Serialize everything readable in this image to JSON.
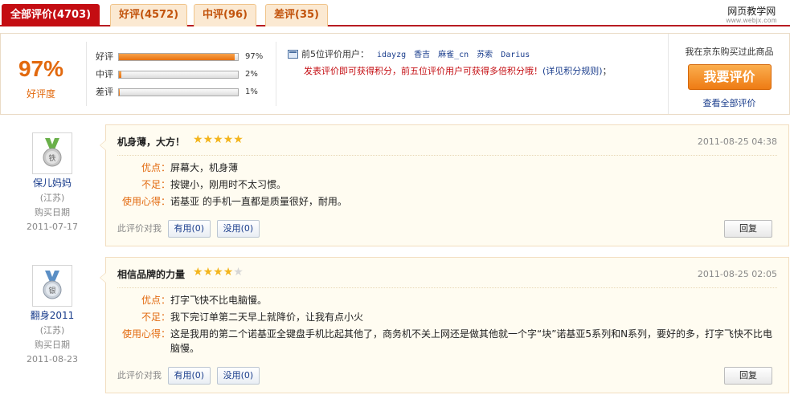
{
  "tabs": [
    {
      "label": "全部评价",
      "count": "(4703)",
      "active": true
    },
    {
      "label": "好评",
      "count": "(4572)",
      "active": false
    },
    {
      "label": "中评",
      "count": "(96)",
      "active": false
    },
    {
      "label": "差评",
      "count": "(35)",
      "active": false
    }
  ],
  "watermark": {
    "title": "网页教学网",
    "url": "www.webjx.com"
  },
  "summary": {
    "percent": "97%",
    "percent_label": "好评度",
    "bars": [
      {
        "name": "好评",
        "value": 0.97,
        "label": "97%"
      },
      {
        "name": "中评",
        "value": 0.02,
        "label": "2%"
      },
      {
        "name": "差评",
        "value": 0.01,
        "label": "1%"
      }
    ],
    "top_users_label": "前5位评价用户：",
    "top_users": [
      "idayzg",
      "香吉",
      "麻雀_cn",
      "苏索",
      "Darius"
    ],
    "notice": "发表评价即可获得积分，前五位评价用户可获得多倍积分哦！",
    "notice_link": "(详见积分规则)",
    "notice_tail": "；",
    "buy_question": "我在京东购买过此商品",
    "buy_button": "我要评价",
    "view_all": "查看全部评价"
  },
  "reviews": [
    {
      "user": "保儿妈妈",
      "province": "(江苏)",
      "buy_label": "购买日期",
      "buy_date": "2011-07-17",
      "medal_char": "铁",
      "medal_color": "#6ab04a",
      "title": "机身薄，大方！",
      "rating": 5,
      "time": "2011-08-25 04:38",
      "pros_label": "优点：",
      "pros": "屏幕大，机身薄",
      "cons_label": "不足：",
      "cons": "按键小，刚用时不太习惯。",
      "exp_label": "使用心得：",
      "exp": "诺基亚 的手机一直都是质量很好，耐用。",
      "useful_label": "此评价对我",
      "useful_yes": "有用(0)",
      "useful_no": "没用(0)",
      "reply": "回复"
    },
    {
      "user": "翻身2011",
      "province": "(江苏)",
      "buy_label": "购买日期",
      "buy_date": "2011-08-23",
      "medal_char": "银",
      "medal_color": "#5b8fc5",
      "title": "相信品牌的力量",
      "rating": 4,
      "time": "2011-08-25 02:05",
      "pros_label": "优点：",
      "pros": "打字飞快不比电脑慢。",
      "cons_label": "不足：",
      "cons": "我下完订单第二天早上就降价，让我有点小火",
      "exp_label": "使用心得：",
      "exp": "这是我用的第二个诺基亚全键盘手机比起其他了，商务机不关上网还是做其他就一个字“块”诺基亚5系列和N系列，要好的多，打字飞快不比电脑慢。",
      "useful_label": "此评价对我",
      "useful_yes": "有用(0)",
      "useful_no": "没用(0)",
      "reply": "回复"
    }
  ]
}
